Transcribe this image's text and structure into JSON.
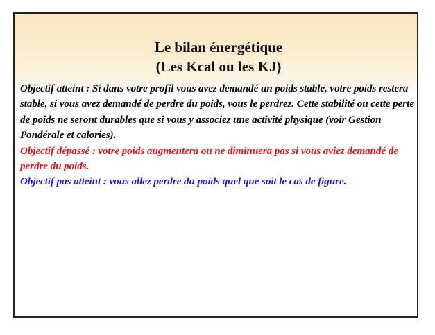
{
  "slide": {
    "title_line1": "Le bilan énergétique",
    "title_line2": "(Les Kcal ou les KJ)",
    "paragraphs": {
      "atteint": "Objectif atteint : Si dans votre profil vous avez demandé un poids stable, votre poids restera stable, si vous avez demandé de perdre du poids, vous le perdrez. Cette stabilité ou cette perte de poids ne seront durables que si vous y associez une activité physique (voir Gestion Pondérale et calories).",
      "depasse": "Objectif dépassé : votre poids augmentera ou ne diminuera pas si vous aviez demandé de perdre du poids.",
      "pas_atteint": "Objectif pas atteint : vous allez perdre du poids quel que soit le cas de figure."
    }
  },
  "colors": {
    "atteint": "#000000",
    "depasse": "#e8141b",
    "pas_atteint": "#1a1ad6",
    "header_background": "#f9e6bf"
  }
}
